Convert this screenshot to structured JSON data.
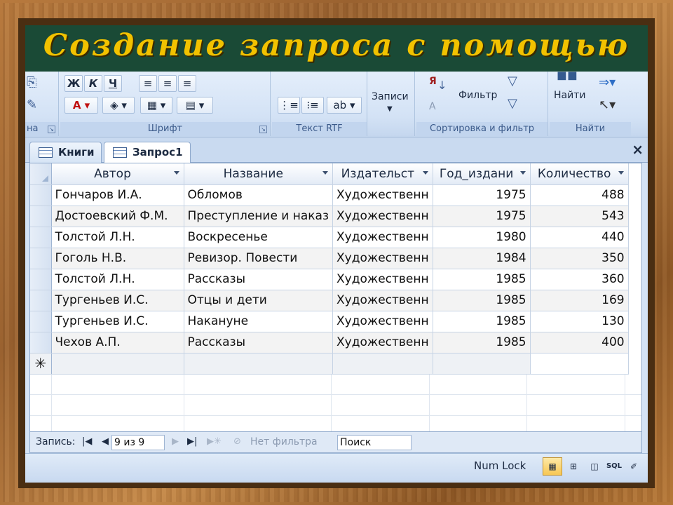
{
  "slide": {
    "title": "Создание запроса с помощью"
  },
  "ribbon": {
    "groups": {
      "clipboard_partial": "на",
      "font": "Шрифт",
      "rtf": "Текст RTF",
      "records": "Записи",
      "sort_filter": "Сортировка и фильтр",
      "find": "Найти"
    },
    "font_buttons": {
      "bold": "Ж",
      "italic": "К",
      "underline": "Ч"
    },
    "filter_label": "Фильтр",
    "find_label": "Найти",
    "records_label": "Записи",
    "sort_glyph_top": "Я",
    "sort_glyph_bottom": "А"
  },
  "tabs": [
    {
      "label": "Книги",
      "active": false
    },
    {
      "label": "Запрос1",
      "active": true
    }
  ],
  "close_glyph": "×",
  "table": {
    "columns": [
      "Автор",
      "Название",
      "Издательст",
      "Год_издани",
      "Количество"
    ],
    "rows": [
      [
        "Гончаров И.А.",
        "Обломов",
        "Художественн",
        "1975",
        "488"
      ],
      [
        "Достоевский Ф.М.",
        "Преступление и наказ",
        "Художественн",
        "1975",
        "543"
      ],
      [
        "Толстой Л.Н.",
        "Воскресенье",
        "Художественн",
        "1980",
        "440"
      ],
      [
        "Гоголь Н.В.",
        "Ревизор. Повести",
        "Художественн",
        "1984",
        "350"
      ],
      [
        "Толстой Л.Н.",
        "Рассказы",
        "Художественн",
        "1985",
        "360"
      ],
      [
        "Тургеньев И.С.",
        "Отцы и дети",
        "Художественн",
        "1985",
        "169"
      ],
      [
        "Тургеньев И.С.",
        "Накануне",
        "Художественн",
        "1985",
        "130"
      ],
      [
        "Чехов А.П.",
        "Рассказы",
        "Художественн",
        "1985",
        "400"
      ]
    ],
    "new_row_marker": "✳"
  },
  "navbar": {
    "records_label": "Запись:",
    "position": "9 из 9",
    "filter_status": "Нет фильтра",
    "search_placeholder": "Поиск"
  },
  "statusbar": {
    "numlock": "Num Lock",
    "sql": "SQL"
  }
}
